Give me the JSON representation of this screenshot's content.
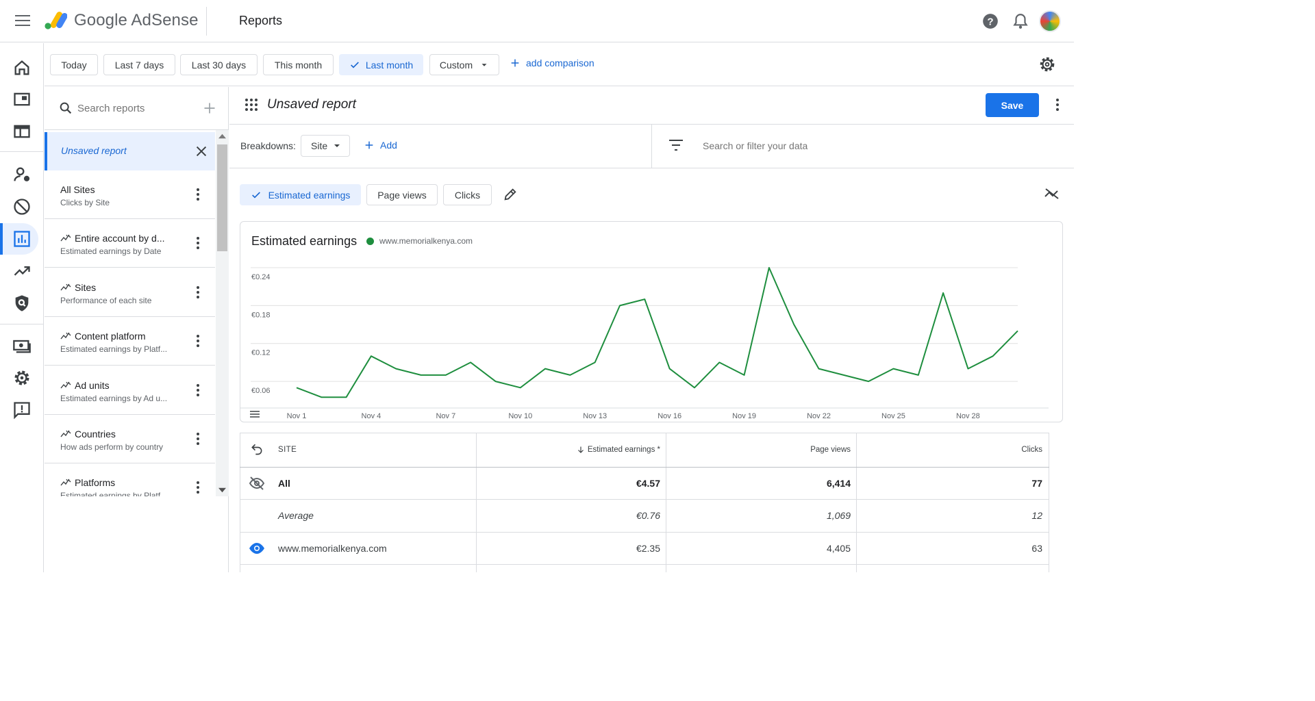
{
  "header": {
    "brand": "Google AdSense",
    "page_title": "Reports",
    "icons": [
      "menu-icon",
      "help-icon",
      "notifications-icon",
      "avatar"
    ]
  },
  "rail": {
    "items": [
      "home-icon",
      "ads-icon",
      "layout-icon",
      "audience-icon",
      "block-icon",
      "reports-icon",
      "trend-icon",
      "policy-icon",
      "payments-icon",
      "settings-icon",
      "feedback-icon"
    ],
    "active": "reports-icon"
  },
  "date_range": {
    "chips": [
      "Today",
      "Last 7 days",
      "Last 30 days",
      "This month",
      "Last month",
      "Custom"
    ],
    "selected": "Last month",
    "add_comparison": "add comparison"
  },
  "reports_panel": {
    "search_placeholder": "Search reports",
    "active": "Unsaved report",
    "items": [
      {
        "title": "All Sites",
        "subtitle": "Clicks by Site",
        "starred": false
      },
      {
        "title": "Entire account by d...",
        "subtitle": "Estimated earnings by Date",
        "starred": true
      },
      {
        "title": "Sites",
        "subtitle": "Performance of each site",
        "starred": true
      },
      {
        "title": "Content platform",
        "subtitle": "Estimated earnings by Platf...",
        "starred": true
      },
      {
        "title": "Ad units",
        "subtitle": "Estimated earnings by Ad u...",
        "starred": true
      },
      {
        "title": "Countries",
        "subtitle": "How ads perform by country",
        "starred": true
      },
      {
        "title": "Platforms",
        "subtitle": "Estimated earnings by Platf...",
        "starred": true
      }
    ]
  },
  "report": {
    "title": "Unsaved report",
    "save_label": "Save",
    "breakdowns_label": "Breakdowns:",
    "breakdown_value": "Site",
    "add_label": "Add",
    "filter_placeholder": "Search or filter your data",
    "metrics": [
      "Estimated earnings",
      "Page views",
      "Clicks"
    ],
    "selected_metric": "Estimated earnings"
  },
  "chart_data": {
    "type": "line",
    "title": "Estimated earnings",
    "legend": "www.memorialkenya.com",
    "series_color": "#1e8e3e",
    "ylim": [
      0.02,
      0.24
    ],
    "y_ticks": [
      "€0.06",
      "€0.12",
      "€0.18",
      "€0.24"
    ],
    "y_tick_values": [
      0.06,
      0.12,
      0.18,
      0.24
    ],
    "x_tick_labels": [
      "Nov 1",
      "Nov 4",
      "Nov 7",
      "Nov 10",
      "Nov 13",
      "Nov 16",
      "Nov 19",
      "Nov 22",
      "Nov 25",
      "Nov 28"
    ],
    "x": [
      1,
      2,
      3,
      4,
      5,
      6,
      7,
      8,
      9,
      10,
      11,
      12,
      13,
      14,
      15,
      16,
      17,
      18,
      19,
      20,
      21,
      22,
      23,
      24,
      25,
      26,
      27,
      28,
      29,
      30
    ],
    "values": [
      0.05,
      0.035,
      0.035,
      0.1,
      0.08,
      0.07,
      0.07,
      0.09,
      0.06,
      0.05,
      0.08,
      0.07,
      0.09,
      0.18,
      0.19,
      0.08,
      0.05,
      0.09,
      0.07,
      0.24,
      0.15,
      0.08,
      0.07,
      0.06,
      0.08,
      0.07,
      0.2,
      0.08,
      0.1,
      0.14
    ]
  },
  "table": {
    "columns": [
      "SITE",
      "Estimated earnings *",
      "Page views",
      "Clicks"
    ],
    "rows": [
      {
        "site": "All",
        "earnings": "€4.57",
        "page_views": "6,414",
        "clicks": "77",
        "style": "bold",
        "icon": "visibility-off-icon"
      },
      {
        "site": "Average",
        "earnings": "€0.76",
        "page_views": "1,069",
        "clicks": "12",
        "style": "italic",
        "icon": ""
      },
      {
        "site": "www.memorialkenya.com",
        "earnings": "€2.35",
        "page_views": "4,405",
        "clicks": "63",
        "style": "normal",
        "icon": "visibility-icon"
      }
    ]
  }
}
